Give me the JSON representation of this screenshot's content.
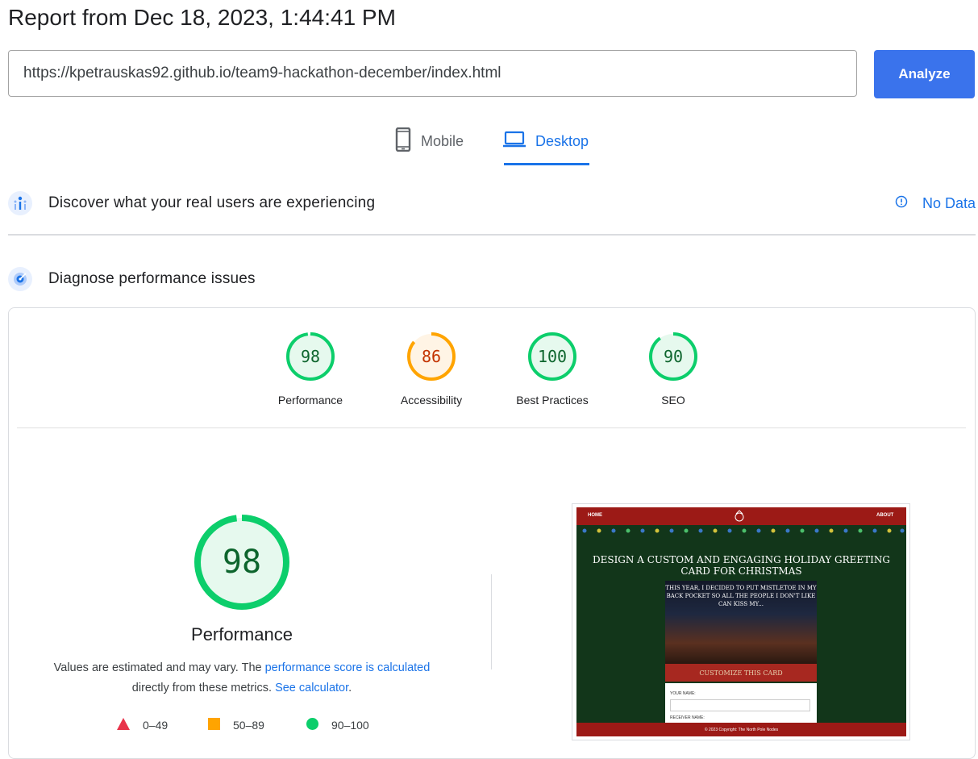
{
  "header": {
    "title": "Report from Dec 18, 2023, 1:44:41 PM",
    "url_value": "https://kpetrauskas92.github.io/team9-hackathon-december/index.html",
    "analyze_label": "Analyze"
  },
  "tabs": [
    {
      "label": "Mobile",
      "icon": "phone-icon",
      "selected": false
    },
    {
      "label": "Desktop",
      "icon": "laptop-icon",
      "selected": true
    }
  ],
  "field_data": {
    "title": "Discover what your real users are experiencing",
    "status": "No Data"
  },
  "diagnose": {
    "title": "Diagnose performance issues"
  },
  "scores": [
    {
      "label": "Performance",
      "value": "98",
      "score": 98,
      "color": "#0cce6b",
      "text_color": "#0d652d",
      "bg": "#e6f9ee"
    },
    {
      "label": "Accessibility",
      "value": "86",
      "score": 86,
      "color": "#ffa400",
      "text_color": "#c33300",
      "bg": "#fff4e5"
    },
    {
      "label": "Best Practices",
      "value": "100",
      "score": 100,
      "color": "#0cce6b",
      "text_color": "#0d652d",
      "bg": "#e6f9ee"
    },
    {
      "label": "SEO",
      "value": "90",
      "score": 90,
      "color": "#0cce6b",
      "text_color": "#0d652d",
      "bg": "#e6f9ee"
    }
  ],
  "performance": {
    "score": "98",
    "title": "Performance",
    "desc_before": "Values are estimated and may vary. The ",
    "desc_link1": "performance score is calculated",
    "desc_middle": " directly from these metrics. ",
    "desc_link2": "See calculator",
    "desc_end": "."
  },
  "legend": [
    {
      "shape": "triangle",
      "label": "0–49",
      "color": "#e8334a"
    },
    {
      "shape": "square",
      "label": "50–89",
      "color": "#ffa400"
    },
    {
      "shape": "circle",
      "label": "90–100",
      "color": "#0cce6b"
    }
  ],
  "screenshot": {
    "nav_home": "HOME",
    "nav_about": "ABOUT",
    "heading": "DESIGN A CUSTOM AND ENGAGING HOLIDAY GREETING CARD FOR CHRISTMAS",
    "card_text": "THIS YEAR, I DECIDED TO PUT MISTLETOE IN MY BACK POCKET SO ALL THE PEOPLE I DON'T LIKE CAN KISS MY...",
    "customize": "CUSTOMIZE THIS CARD",
    "your_name": "YOUR NAME:",
    "receiver_name": "RECEIVER NAME:",
    "footer": "© 2023 Copyright: The North Pole Nodes"
  }
}
